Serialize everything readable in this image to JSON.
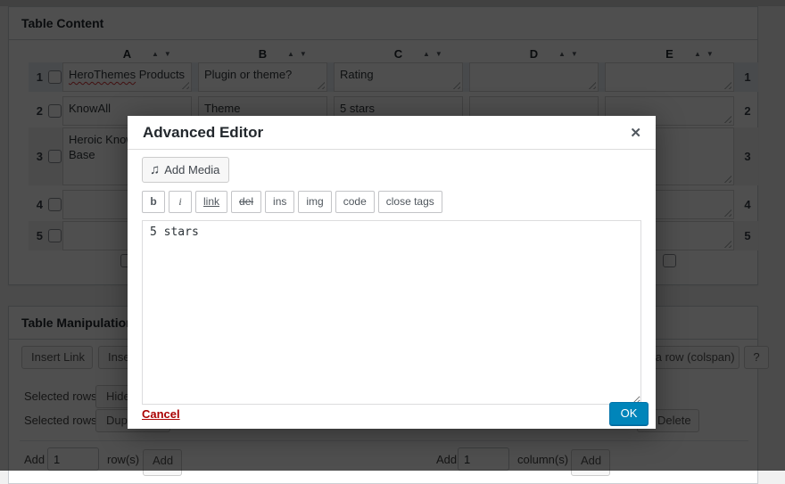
{
  "table_content": {
    "title": "Table Content",
    "sort_asc": "▲",
    "sort_desc": "▼",
    "columns": [
      "A",
      "B",
      "C",
      "D",
      "E"
    ],
    "rows": [
      {
        "number": "1",
        "a_misspelled": "HeroThemes",
        "a_rest": " Products",
        "b": "Plugin or theme?",
        "c": "Rating",
        "d": "",
        "e": ""
      },
      {
        "number": "2",
        "a": "KnowAll",
        "b": "Theme",
        "c": "5 stars",
        "d": "",
        "e": ""
      },
      {
        "number": "3",
        "a": "Heroic Knowledge Base",
        "b": "",
        "c": "",
        "d": "",
        "e": ""
      },
      {
        "number": "4",
        "a": "",
        "b": "",
        "c": "",
        "d": "",
        "e": ""
      },
      {
        "number": "5",
        "a": "",
        "b": "",
        "c": "",
        "d": "",
        "e": ""
      }
    ]
  },
  "modal": {
    "title": "Advanced Editor",
    "close_icon": "✕",
    "add_media": {
      "icon": "♫",
      "label": "Add Media"
    },
    "quicktags": [
      "b",
      "i",
      "link",
      "del",
      "ins",
      "img",
      "code",
      "close tags"
    ],
    "content": "5 stars",
    "cancel_label": "Cancel",
    "ok_label": "OK",
    "accent_color": "#0085ba",
    "cancel_color": "#aa0000"
  },
  "table_manipulation": {
    "title": "Table Manipulation",
    "insert_link": "Insert Link",
    "insert_image": "Insert Image",
    "combine_row": "in a row (colspan)",
    "help": "?",
    "selected_rows": "Selected rows:",
    "hide": "Hide",
    "duplicate": "Duplicate",
    "delete": "Delete",
    "add_rows": {
      "label": "Add",
      "count": "1",
      "unit": "row(s)",
      "button": "Add"
    },
    "add_columns": {
      "label": "Add",
      "count": "1",
      "unit": "column(s)",
      "button": "Add"
    }
  }
}
